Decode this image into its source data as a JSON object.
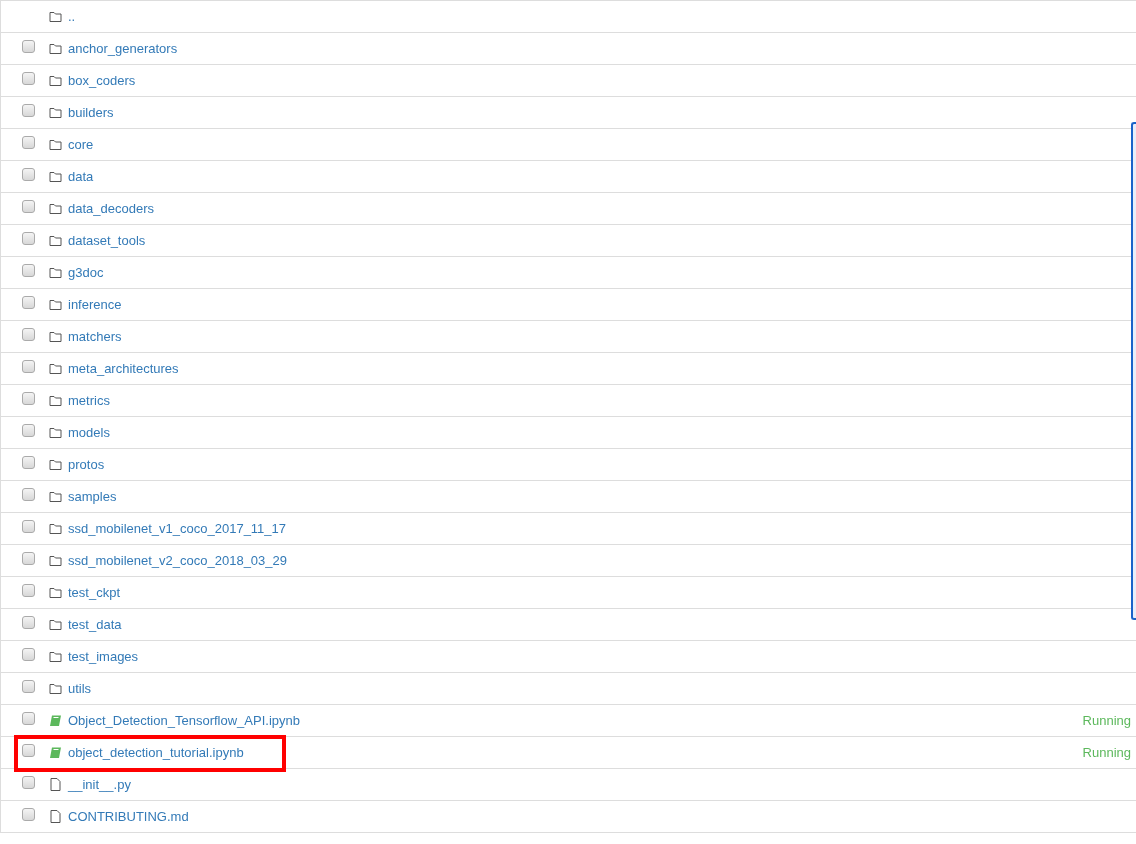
{
  "items": [
    {
      "kind": "parent",
      "name": "..",
      "highlighted": false
    },
    {
      "kind": "folder",
      "name": "anchor_generators",
      "checked": false,
      "highlighted": false
    },
    {
      "kind": "folder",
      "name": "box_coders",
      "checked": false,
      "highlighted": false
    },
    {
      "kind": "folder",
      "name": "builders",
      "checked": false,
      "highlighted": false
    },
    {
      "kind": "folder",
      "name": "core",
      "checked": false,
      "highlighted": false
    },
    {
      "kind": "folder",
      "name": "data",
      "checked": false,
      "highlighted": false
    },
    {
      "kind": "folder",
      "name": "data_decoders",
      "checked": false,
      "highlighted": false
    },
    {
      "kind": "folder",
      "name": "dataset_tools",
      "checked": false,
      "highlighted": false
    },
    {
      "kind": "folder",
      "name": "g3doc",
      "checked": false,
      "highlighted": false
    },
    {
      "kind": "folder",
      "name": "inference",
      "checked": false,
      "highlighted": false
    },
    {
      "kind": "folder",
      "name": "matchers",
      "checked": false,
      "highlighted": false
    },
    {
      "kind": "folder",
      "name": "meta_architectures",
      "checked": false,
      "highlighted": false
    },
    {
      "kind": "folder",
      "name": "metrics",
      "checked": false,
      "highlighted": false
    },
    {
      "kind": "folder",
      "name": "models",
      "checked": false,
      "highlighted": false
    },
    {
      "kind": "folder",
      "name": "protos",
      "checked": false,
      "highlighted": false
    },
    {
      "kind": "folder",
      "name": "samples",
      "checked": false,
      "highlighted": false
    },
    {
      "kind": "folder",
      "name": "ssd_mobilenet_v1_coco_2017_11_17",
      "checked": false,
      "highlighted": false
    },
    {
      "kind": "folder",
      "name": "ssd_mobilenet_v2_coco_2018_03_29",
      "checked": false,
      "highlighted": false
    },
    {
      "kind": "folder",
      "name": "test_ckpt",
      "checked": false,
      "highlighted": false
    },
    {
      "kind": "folder",
      "name": "test_data",
      "checked": false,
      "highlighted": false
    },
    {
      "kind": "folder",
      "name": "test_images",
      "checked": false,
      "highlighted": false
    },
    {
      "kind": "folder",
      "name": "utils",
      "checked": false,
      "highlighted": false
    },
    {
      "kind": "notebook",
      "name": "Object_Detection_Tensorflow_API.ipynb",
      "checked": false,
      "status": "Running",
      "highlighted": false
    },
    {
      "kind": "notebook",
      "name": "object_detection_tutorial.ipynb",
      "checked": false,
      "status": "Running",
      "highlighted": true
    },
    {
      "kind": "file",
      "name": "__init__.py",
      "checked": false,
      "highlighted": false
    },
    {
      "kind": "file",
      "name": "CONTRIBUTING.md",
      "checked": false,
      "highlighted": false
    }
  ]
}
